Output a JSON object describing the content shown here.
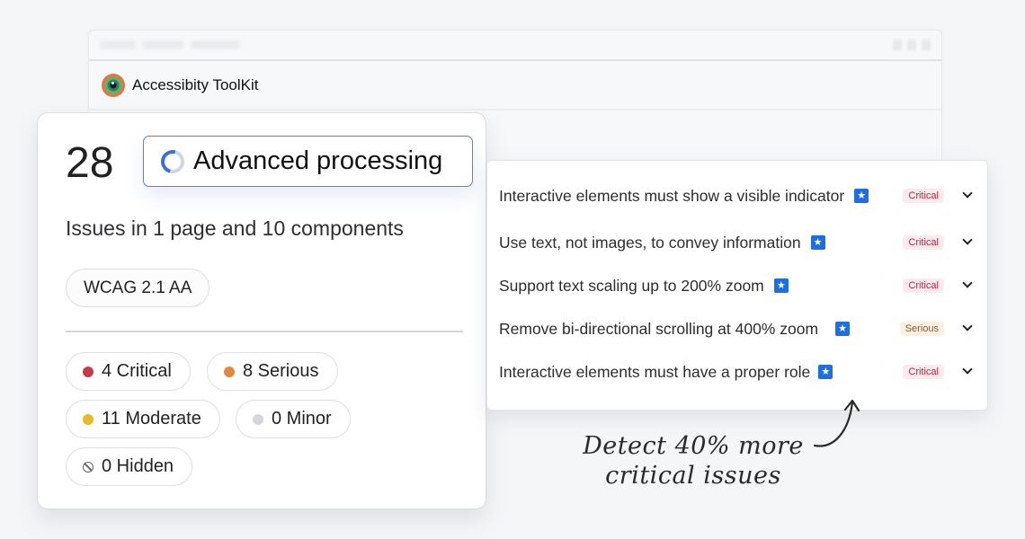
{
  "window": {
    "app_title": "Accessibity ToolKit",
    "logo_icon": "eye-logo-icon"
  },
  "summary": {
    "issue_count": "28",
    "processing_label": "Advanced processing",
    "processing_icon": "spinner-icon",
    "issues_text": "Issues in 1 page and 10 components",
    "standard": "WCAG 2.1 AA"
  },
  "severity_filters": [
    {
      "label": "4 Critical",
      "count": 4,
      "name": "Critical",
      "color": "#c53c45"
    },
    {
      "label": "8 Serious",
      "count": 8,
      "name": "Serious",
      "color": "#e08a3a"
    },
    {
      "label": "11 Moderate",
      "count": 11,
      "name": "Moderate",
      "color": "#e6b928"
    },
    {
      "label": "0 Minor",
      "count": 0,
      "name": "Minor",
      "color": "#d3d6da"
    },
    {
      "label": "0 Hidden",
      "count": 0,
      "name": "Hidden",
      "icon": "hidden-icon"
    }
  ],
  "issues": [
    {
      "title": "Interactive elements must show a visible indicator",
      "severity": "Critical",
      "badge_icon": "star-icon"
    },
    {
      "title": "Use text, not images, to convey information",
      "severity": "Critical",
      "badge_icon": "star-icon"
    },
    {
      "title": "Support text scaling up to 200% zoom",
      "severity": "Critical",
      "badge_icon": "star-icon"
    },
    {
      "title": "Remove bi-directional scrolling at 400% zoom",
      "severity": "Serious",
      "badge_icon": "star-icon"
    },
    {
      "title": "Interactive elements must have a proper role",
      "severity": "Critical",
      "badge_icon": "star-icon"
    }
  ],
  "annotation": {
    "line1": "Detect 40% more",
    "line2": "critical issues"
  },
  "colors": {
    "accent": "#1b6fe0",
    "critical_bg": "#fdeaec",
    "critical_text": "#b3263a",
    "serious_bg": "#fdf0e0",
    "serious_text": "#8a5a22"
  }
}
